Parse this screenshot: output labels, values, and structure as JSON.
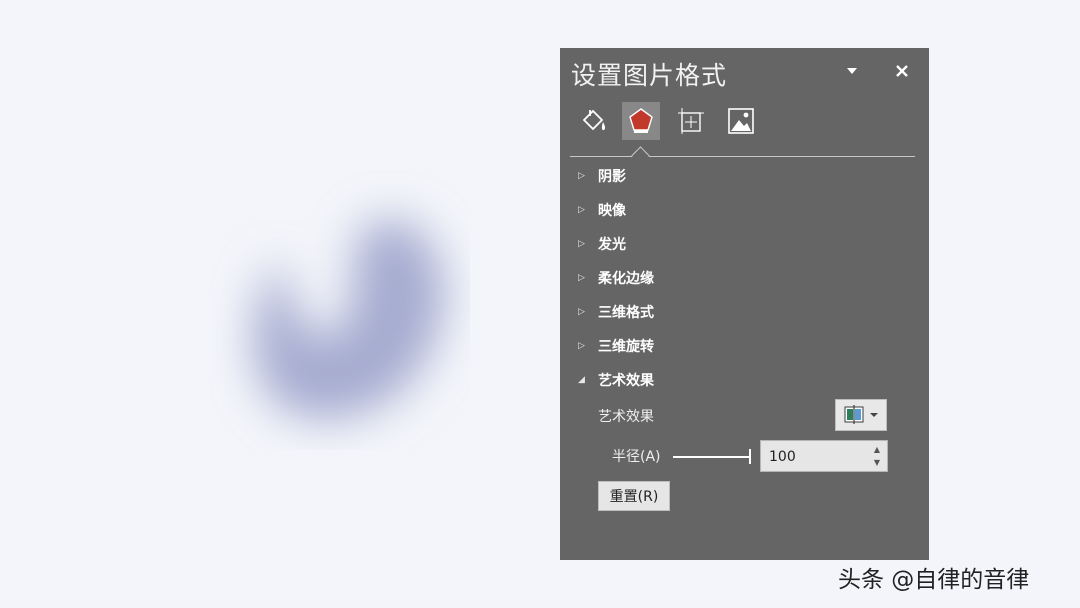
{
  "panel": {
    "title": "设置图片格式",
    "dropdown_icon": "triangle-down-icon",
    "close_icon": "close-icon",
    "tabs": [
      {
        "icon": "fill-bucket-icon"
      },
      {
        "icon": "effects-pentagon-icon",
        "active": true
      },
      {
        "icon": "size-properties-icon"
      },
      {
        "icon": "picture-icon"
      }
    ],
    "sections": [
      {
        "label": "阴影",
        "expanded": false
      },
      {
        "label": "映像",
        "expanded": false
      },
      {
        "label": "发光",
        "expanded": false
      },
      {
        "label": "柔化边缘",
        "expanded": false
      },
      {
        "label": "三维格式",
        "expanded": false
      },
      {
        "label": "三维旋转",
        "expanded": false
      },
      {
        "label": "艺术效果",
        "expanded": true
      }
    ],
    "artistic": {
      "effect_label": "艺术效果",
      "radius_label": "半径(A)",
      "radius_value": "100",
      "reset_label": "重置(R)"
    }
  },
  "watermark": "头条 @自律的音律",
  "colors": {
    "panel_bg": "#656565",
    "canvas_bg": "#f3f5fa",
    "blob": "#a9afd2"
  }
}
